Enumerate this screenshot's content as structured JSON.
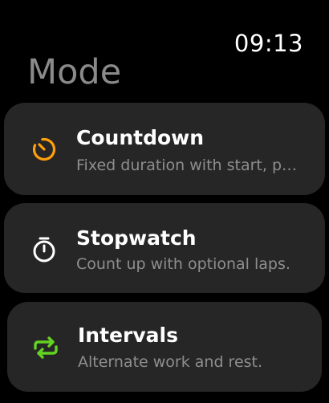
{
  "status": {
    "time": "09:13"
  },
  "header": {
    "title": "Mode"
  },
  "modes": [
    {
      "title": "Countdown",
      "subtitle": "Fixed duration with start, pause, and reset.",
      "icon": "countdown-timer-icon",
      "color": "#FF9F0A"
    },
    {
      "title": "Stopwatch",
      "subtitle": "Count up with optional laps.",
      "icon": "stopwatch-icon",
      "color": "#FFFFFF"
    },
    {
      "title": "Intervals",
      "subtitle": "Alternate work and rest.",
      "icon": "repeat-arrows-icon",
      "color": "#63D321"
    }
  ]
}
